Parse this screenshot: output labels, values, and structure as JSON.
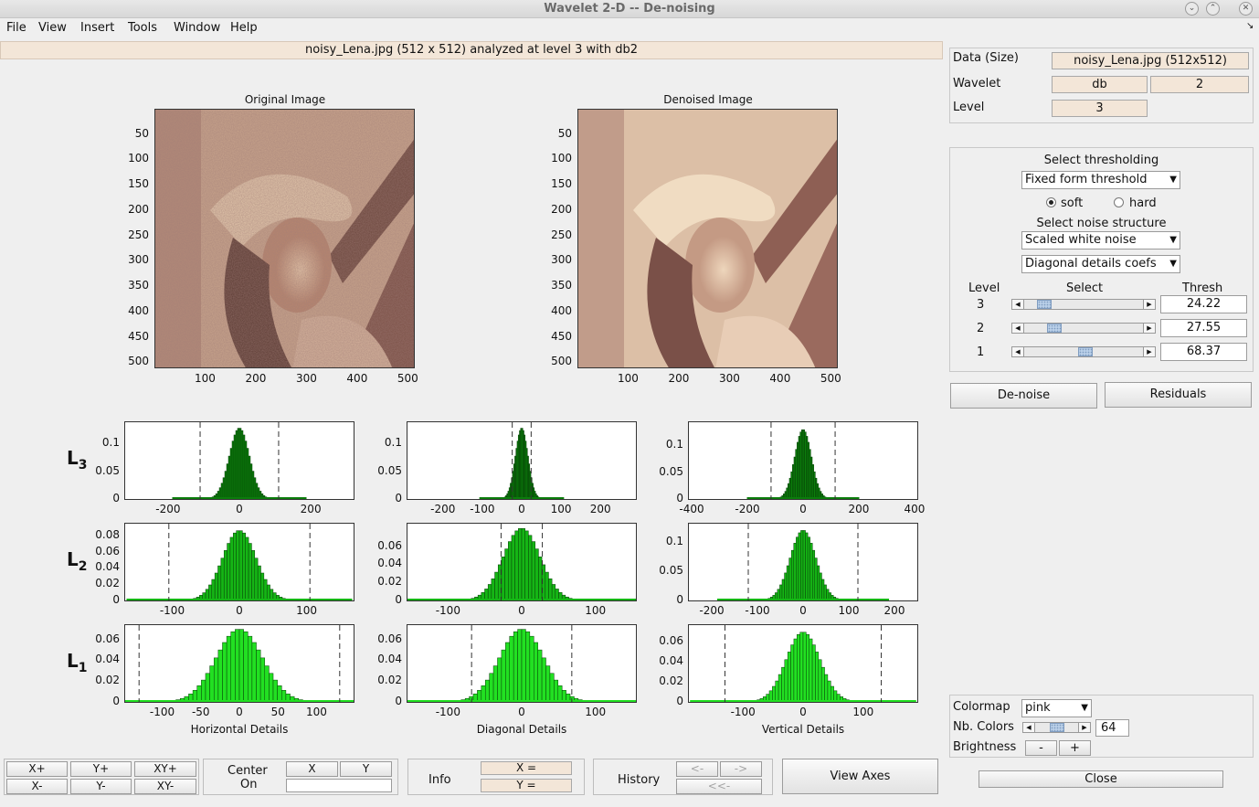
{
  "window": {
    "title": "Wavelet 2-D  --  De-noising"
  },
  "menu": [
    "File",
    "View",
    "Insert",
    "Tools",
    "Window",
    "Help"
  ],
  "banner": "noisy_Lena.jpg  (512 x 512) analyzed at level 3 with db2",
  "images": {
    "original_title": "Original Image",
    "denoised_title": "Denoised Image",
    "y_ticks": [
      "50",
      "100",
      "150",
      "200",
      "250",
      "300",
      "350",
      "400",
      "450",
      "500"
    ],
    "x_ticks": [
      "100",
      "200",
      "300",
      "400",
      "500"
    ]
  },
  "histograms": {
    "level_labels": [
      {
        "L": "L",
        "n": "3"
      },
      {
        "L": "L",
        "n": "2"
      },
      {
        "L": "L",
        "n": "1"
      }
    ],
    "column_titles": [
      "Horizontal Details",
      "Diagonal Details",
      "Vertical Details"
    ],
    "rows": [
      [
        {
          "y": [
            "0.1",
            "0.05",
            "0"
          ],
          "x": [
            "-200",
            "0",
            "200"
          ],
          "xlim": [
            -320,
            320
          ],
          "thr": 110,
          "sigma": 28,
          "ylim": 0.135,
          "peak": 0.128
        },
        {
          "y": [
            "0.1",
            "0.05",
            "0"
          ],
          "x": [
            "-200",
            "-100",
            "0",
            "100",
            "200"
          ],
          "xlim": [
            -290,
            290
          ],
          "thr": 24,
          "sigma": 16,
          "ylim": 0.135,
          "peak": 0.128
        },
        {
          "y": [
            "0.1",
            "0.05",
            "0"
          ],
          "x": [
            "-400",
            "-200",
            "0",
            "200",
            "400"
          ],
          "xlim": [
            -410,
            410
          ],
          "thr": 115,
          "sigma": 30,
          "ylim": 0.14,
          "peak": 0.13
        }
      ],
      [
        {
          "y": [
            "0.08",
            "0.06",
            "0.04",
            "0.02",
            "0"
          ],
          "x": [
            "-100",
            "0",
            "100"
          ],
          "xlim": [
            -170,
            170
          ],
          "thr": 105,
          "sigma": 25,
          "ylim": 0.092,
          "peak": 0.086
        },
        {
          "y": [
            "0.06",
            "0.04",
            "0.02",
            "0"
          ],
          "x": [
            "-100",
            "0",
            "100"
          ],
          "xlim": [
            -155,
            155
          ],
          "thr": 28,
          "sigma": 25,
          "ylim": 0.083,
          "peak": 0.08
        },
        {
          "y": [
            "0.1",
            "0.05",
            "0"
          ],
          "x": [
            "-200",
            "-100",
            "0",
            "100",
            "200"
          ],
          "xlim": [
            -250,
            250
          ],
          "thr": 120,
          "sigma": 28,
          "ylim": 0.128,
          "peak": 0.12
        }
      ],
      [
        {
          "y": [
            "0.06",
            "0.04",
            "0.02",
            "0"
          ],
          "x": [
            "-100",
            "-50",
            "0",
            "50",
            "100"
          ],
          "xlim": [
            -148,
            148
          ],
          "thr": 130,
          "sigma": 30,
          "ylim": 0.072,
          "peak": 0.07
        },
        {
          "y": [
            "0.06",
            "0.04",
            "0.02",
            "0"
          ],
          "x": [
            "-100",
            "0",
            "100"
          ],
          "xlim": [
            -155,
            155
          ],
          "thr": 68,
          "sigma": 30,
          "ylim": 0.072,
          "peak": 0.07
        },
        {
          "y": [
            "0.06",
            "0.04",
            "0.02",
            "0"
          ],
          "x": [
            "-100",
            "0",
            "100"
          ],
          "xlim": [
            -190,
            190
          ],
          "thr": 130,
          "sigma": 28,
          "ylim": 0.075,
          "peak": 0.07
        }
      ]
    ]
  },
  "panel": {
    "data_label": "Data  (Size)",
    "data_value": "noisy_Lena.jpg  (512x512)",
    "wavelet_label": "Wavelet",
    "wavelet_family": "db",
    "wavelet_number": "2",
    "level_label": "Level",
    "level_value": "3",
    "select_thresholding": "Select thresholding",
    "threshold_method": "Fixed form threshold",
    "soft": "soft",
    "hard": "hard",
    "soft_selected": true,
    "select_noise": "Select noise structure",
    "noise_structure": "Scaled white noise",
    "detail_coefs": "Diagonal details coefs",
    "col_level": "Level",
    "col_select": "Select",
    "col_thresh": "Thresh",
    "thresholds": [
      {
        "level": "3",
        "value": "24.22",
        "pos": 0.12
      },
      {
        "level": "2",
        "value": "27.55",
        "pos": 0.22
      },
      {
        "level": "1",
        "value": "68.37",
        "pos": 0.52
      }
    ],
    "denoise_button": "De-noise",
    "residuals_button": "Residuals",
    "colormap_label": "Colormap",
    "colormap_value": "pink",
    "nbcolors_label": "Nb. Colors",
    "nbcolors_value": "64",
    "nbcolors_pos": 0.5,
    "brightness_label": "Brightness",
    "minus": "-",
    "plus": "+",
    "close_button": "Close"
  },
  "bottom": {
    "zoom": [
      "X+",
      "Y+",
      "XY+",
      "X-",
      "Y-",
      "XY-"
    ],
    "center_on": "Center",
    "center_on2": "On",
    "x": "X",
    "y": "Y",
    "info": "Info",
    "info_x": "X =",
    "info_y": "Y =",
    "history": "History",
    "hist_prev": "<-",
    "hist_next": "->",
    "hist_first": "<<-",
    "view_axes": "View Axes"
  },
  "colors": {
    "accent": "#f3e6d8",
    "hist_dark": "#0b7d0b",
    "hist_mid": "#15b515",
    "hist_light": "#22e022"
  }
}
